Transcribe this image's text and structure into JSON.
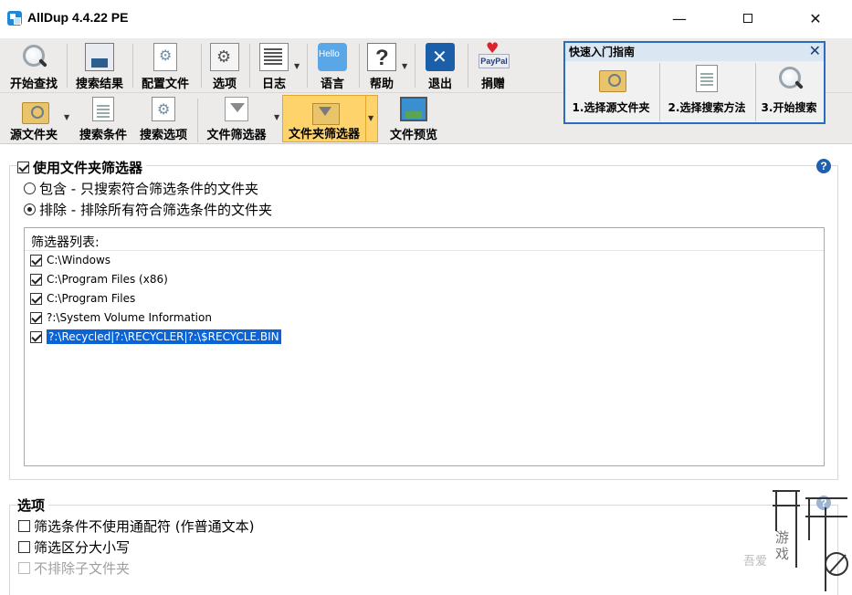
{
  "window": {
    "title": "AllDup 4.4.22 PE",
    "minimize_glyph": "—",
    "close_glyph": "✕"
  },
  "toolbar": {
    "start_search": "开始查找",
    "search_results": "搜索结果",
    "config_file": "配置文件",
    "options": "选项",
    "log": "日志",
    "language": "语言",
    "help": "帮助",
    "exit": "退出",
    "donate": "捐赠"
  },
  "toolbar2": {
    "source_folder": "源文件夹",
    "search_criteria": "搜索条件",
    "search_options": "搜索选项",
    "file_filter": "文件筛选器",
    "folder_filter": "文件夹筛选器",
    "file_preview": "文件预览"
  },
  "quick_start": {
    "title": "快速入门指南",
    "step1": "1.选择源文件夹",
    "step2": "2.选择搜索方法",
    "step3": "3.开始搜索"
  },
  "folder_filter": {
    "use_label": "使用文件夹筛选器",
    "include_label": "包含 - 只搜索符合筛选条件的文件夹",
    "exclude_label": "排除 - 排除所有符合筛选条件的文件夹",
    "list_header": "筛选器列表:",
    "items": [
      "C:\\Windows",
      "C:\\Program Files (x86)",
      "C:\\Program Files",
      "?:\\System Volume Information",
      "?:\\Recycled|?:\\RECYCLER|?:\\$RECYCLE.BIN"
    ]
  },
  "options": {
    "title": "选项",
    "no_wildcards": "筛选条件不使用通配符 (作普通文本)",
    "case_sensitive": "筛选区分大小写",
    "no_exclude_subfolders": "不排除子文件夹"
  },
  "help_icon_glyph": "?",
  "watermark": {
    "chars_1": "游",
    "chars_2": "戏",
    "site": "吾爱"
  }
}
